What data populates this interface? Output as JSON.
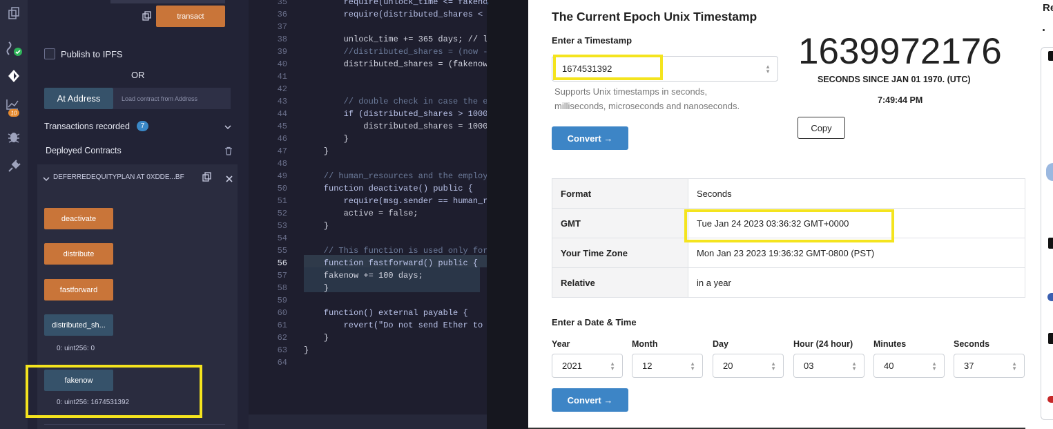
{
  "deploy": {
    "transact_label": "transact",
    "publish_ipfs_label": "Publish to IPFS",
    "or_label": "OR",
    "at_address_label": "At Address",
    "load_address_placeholder": "Load contract from Address",
    "transactions_recorded_label": "Transactions recorded",
    "transactions_count": "7",
    "deployed_contracts_label": "Deployed Contracts",
    "contract_instance_label": "DEFERREDEQUITYPLAN AT 0XDDE...BF",
    "functions": [
      {
        "label": "deactivate",
        "kind": "transact"
      },
      {
        "label": "distribute",
        "kind": "transact"
      },
      {
        "label": "fastforward",
        "kind": "transact"
      },
      {
        "label": "distributed_sh...",
        "kind": "call",
        "result": "0: uint256: 0"
      },
      {
        "label": "fakenow",
        "kind": "call",
        "result": "0: uint256: 1674531392"
      }
    ],
    "analysis_badge": "10"
  },
  "editor": {
    "line_numbers": [
      "35",
      "36",
      "37",
      "38",
      "39",
      "40",
      "41",
      "42",
      "43",
      "44",
      "45",
      "46",
      "47",
      "48",
      "49",
      "50",
      "51",
      "52",
      "53",
      "54",
      "55",
      "56",
      "57",
      "58",
      "59",
      "60",
      "61",
      "62",
      "63",
      "64"
    ],
    "lines": [
      "        require(unlock_time <= fakeno",
      "        require(distributed_shares <",
      "",
      "        unlock_time += 365 days; // l",
      "        //distributed_shares = (now -",
      "        distributed_shares = (fakenow",
      "",
      "",
      "        // double check in case the e",
      "        if (distributed_shares > 1000",
      "            distributed_shares = 1000",
      "        }",
      "    }",
      "",
      "    // human_resources and the employ",
      "    function deactivate() public {",
      "        require(msg.sender == human_r",
      "        active = false;",
      "    }",
      "",
      "    // This function is used only for",
      "    function fastforward() public {",
      "    fakenow += 100 days;",
      "    }",
      "",
      "    function() external payable {",
      "        revert(\"Do not send Ether to",
      "    }",
      "}",
      ""
    ]
  },
  "epoch": {
    "page_title": "The Current Epoch Unix Timestamp",
    "enter_timestamp_label": "Enter a Timestamp",
    "timestamp_value": "1674531392",
    "supports_text_1": "Supports Unix timestamps in seconds,",
    "supports_text_2": "milliseconds, microseconds and nanoseconds.",
    "convert_label": "Convert →",
    "current_timestamp": "1639972176",
    "seconds_since_label": "SECONDS SINCE JAN 01 1970. (UTC)",
    "current_time": "7:49:44 PM",
    "copy_label": "Copy",
    "results": [
      {
        "key": "Format",
        "value": "Seconds"
      },
      {
        "key": "GMT",
        "value": "Tue Jan 24 2023 03:36:32 GMT+0000"
      },
      {
        "key": "Your Time Zone",
        "value": "Mon Jan 23 2023 19:36:32 GMT-0800 (PST)"
      },
      {
        "key": "Relative",
        "value": "in a year"
      }
    ],
    "enter_date_label": "Enter a Date & Time",
    "date_fields": [
      {
        "label": "Year",
        "value": "2021"
      },
      {
        "label": "Month",
        "value": "12"
      },
      {
        "label": "Day",
        "value": "20"
      },
      {
        "label": "Hour (24 hour)",
        "value": "03"
      },
      {
        "label": "Minutes",
        "value": "40"
      },
      {
        "label": "Seconds",
        "value": "37"
      }
    ],
    "right_heading_fragment": "Re"
  },
  "colors": {
    "highlight": "#f4e41e",
    "transact_button": "#c97539",
    "call_button": "#36526a",
    "convert_button": "#3d85c6"
  }
}
